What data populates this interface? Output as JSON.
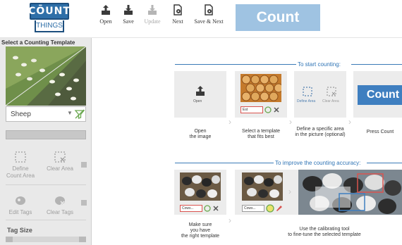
{
  "logo": {
    "line1": "CŌUNT",
    "line2": "THINGS"
  },
  "toolbar": {
    "open": "Open",
    "save": "Save",
    "update": "Update",
    "next": "Next",
    "save_next": "Save & Next",
    "count": "Count"
  },
  "sidebar": {
    "title": "Select a Counting Template",
    "template_value": "Sheep",
    "define_count_area": "Define Count Area",
    "clear_area": "Clear Area",
    "edit_tags": "Edit Tags",
    "clear_tags": "Clear Tags",
    "tag_size_label": "Tag Size"
  },
  "guide": {
    "start_title": "To start counting:",
    "improve_title": "To improve the counting accuracy:",
    "open_icon_label": "Open",
    "card1_caption_1": "Open",
    "card1_caption_2": "the image",
    "card2_select": "Est",
    "card2_caption_1": "Select a template",
    "card2_caption_2": "that fits best",
    "define_area_mini": "Define Area",
    "clear_area_mini": "Clear Area",
    "card3_caption_1": "Define a specific area",
    "card3_caption_2": "in the picture (optional)",
    "count_button": "Count",
    "card4_caption": "Press Count",
    "row2_select_1": "Cows...",
    "row2_select_2": "Cows...",
    "card5_caption_1": "Make sure",
    "card5_caption_2": "you have",
    "card5_caption_3": "the right template",
    "card6_caption_1": "Use the calibrating tool",
    "card6_caption_2": "to fine-tune the selected template"
  },
  "colors": {
    "accent": "#2f74b5",
    "count_button": "#3f7fc0",
    "count_disabled": "#9fc3e2"
  }
}
